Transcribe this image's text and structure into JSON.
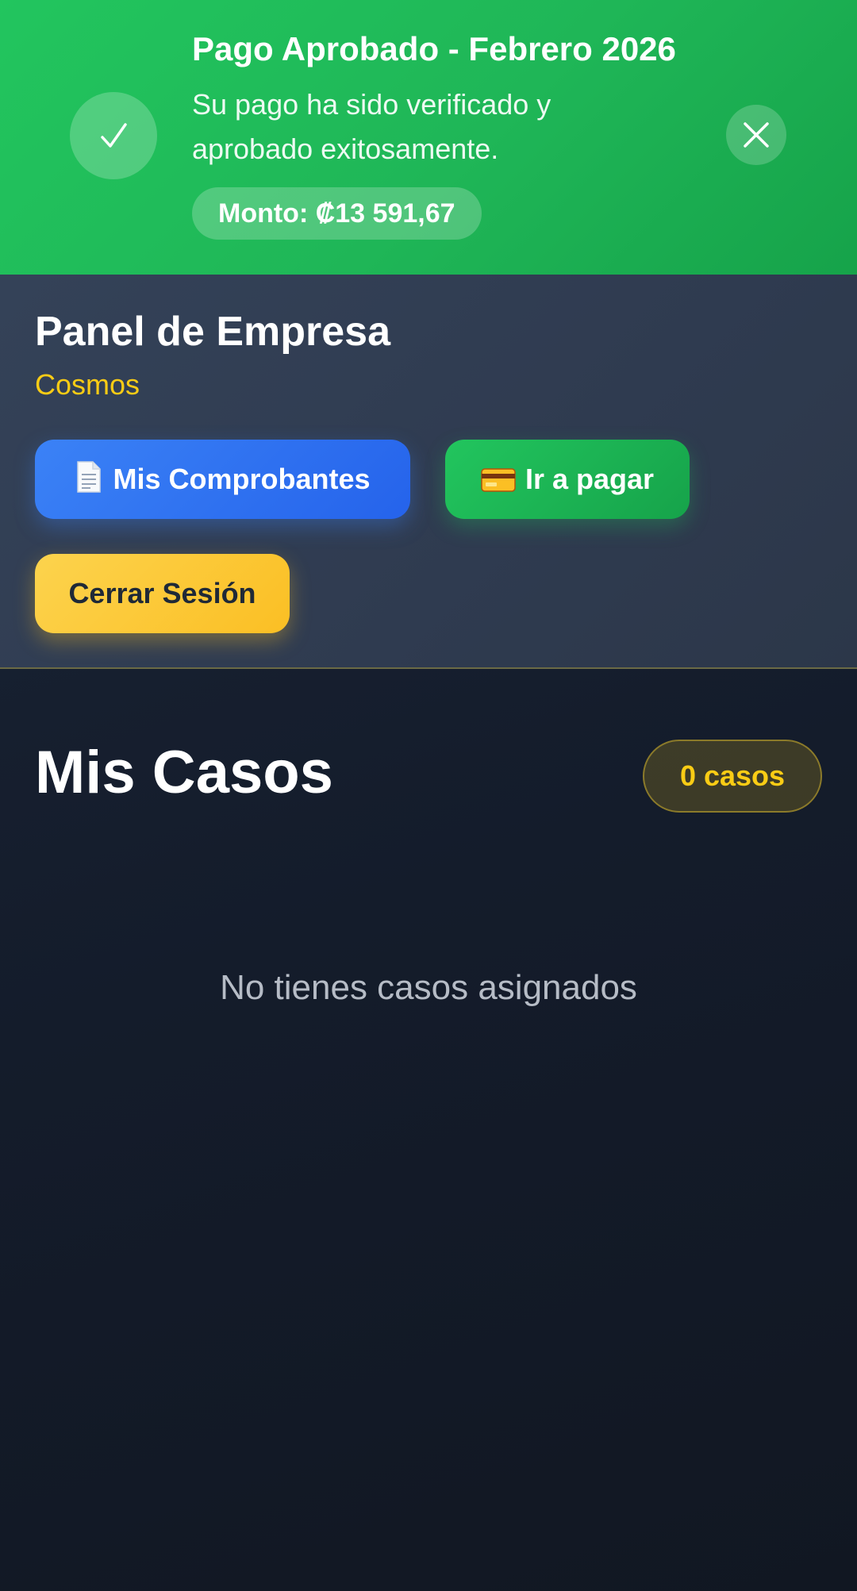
{
  "notification": {
    "title": "Pago Aprobado - Febrero 2026",
    "message": "Su pago ha sido verificado y aprobado exitosamente.",
    "amount": "Monto: ₡13 591,67",
    "icon": "check-icon",
    "close_icon": "close-icon"
  },
  "header": {
    "title": "Panel de Empresa",
    "company": "Cosmos",
    "buttons": {
      "receipts_label": "Mis Comprobantes",
      "receipts_icon": "document-icon",
      "pay_label": "Ir a pagar",
      "pay_icon": "credit-card-icon",
      "logout_label": "Cerrar Sesión"
    }
  },
  "cases": {
    "title": "Mis Casos",
    "count_badge": "0 casos",
    "empty_message": "No tienes casos asignados"
  },
  "colors": {
    "success": "#22c55e",
    "primary": "#3b82f6",
    "accent": "#facc15",
    "background": "#141c2b"
  }
}
